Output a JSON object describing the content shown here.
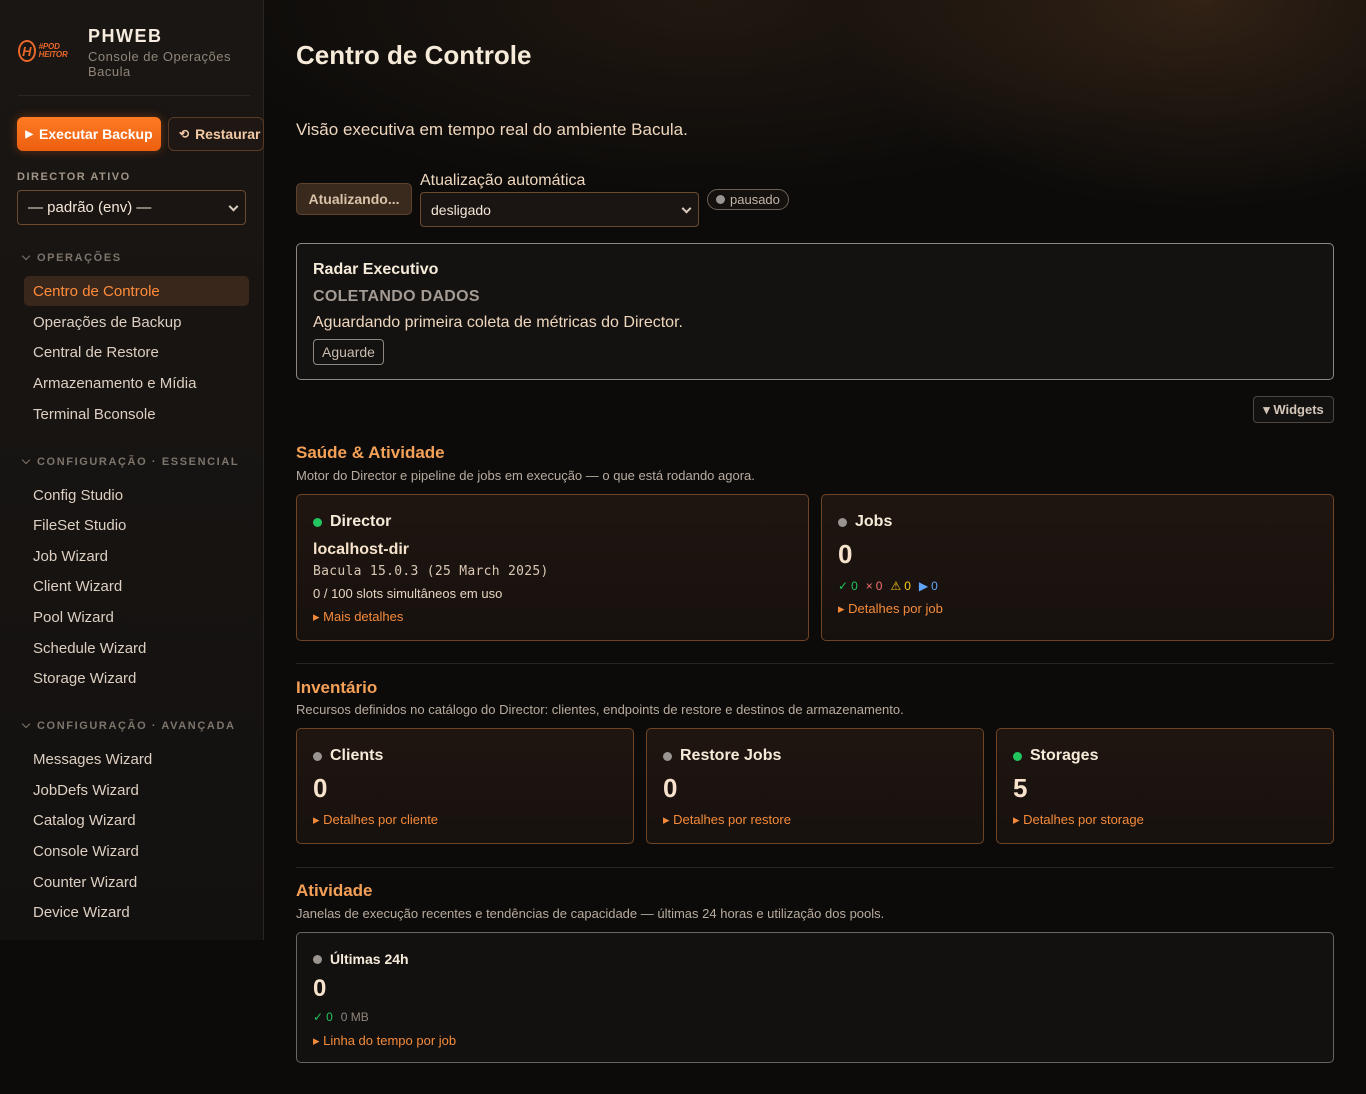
{
  "brand": {
    "logo_h": "H",
    "logo_text": "#POD HEITOR",
    "name": "PHWEB",
    "subtitle": "Console de Operações Bacula"
  },
  "sidebar": {
    "backup_label": "Executar Backup",
    "restore_label": "Restaurar",
    "director_label": "DIRECTOR ATIVO",
    "director_value": "— padrão (env) —",
    "sections": [
      {
        "title": "OPERAÇÕES",
        "items": [
          "Centro de Controle",
          "Operações de Backup",
          "Central de Restore",
          "Armazenamento e Mídia",
          "Terminal Bconsole"
        ]
      },
      {
        "title": "CONFIGURAÇÃO · ESSENCIAL",
        "items": [
          "Config Studio",
          "FileSet Studio",
          "Job Wizard",
          "Client Wizard",
          "Pool Wizard",
          "Schedule Wizard",
          "Storage Wizard"
        ]
      },
      {
        "title": "CONFIGURAÇÃO · AVANÇADA",
        "items": [
          "Messages Wizard",
          "JobDefs Wizard",
          "Catalog Wizard",
          "Console Wizard",
          "Counter Wizard",
          "Device Wizard"
        ]
      }
    ],
    "active_item": "Centro de Controle"
  },
  "header": {
    "title": "Centro de Controle",
    "subtitle": "Visão executiva em tempo real do ambiente Bacula.",
    "refresh_label": "Atualizando...",
    "auto_label": "Atualização automática",
    "auto_value": "desligado",
    "status_pill": "pausado"
  },
  "radar": {
    "title": "Radar Executivo",
    "status": "COLETANDO DADOS",
    "message": "Aguardando primeira coleta de métricas do Director.",
    "tag": "Aguarde"
  },
  "widgets_label": "▾ Widgets",
  "health": {
    "title": "Saúde & Atividade",
    "desc": "Motor do Director e pipeline de jobs em execução — o que está rodando agora.",
    "director": {
      "label": "Director",
      "host": "localhost-dir",
      "version": "Bacula 15.0.3 (25 March 2025)",
      "slots": "0 / 100 slots simultâneos em uso",
      "link": "▸ Mais detalhes"
    },
    "jobs": {
      "label": "Jobs",
      "value": "0",
      "ok": "0",
      "error": "0",
      "warn": "0",
      "running": "0",
      "link": "▸ Detalhes por job"
    }
  },
  "inventory": {
    "title": "Inventário",
    "desc": "Recursos definidos no catálogo do Director: clientes, endpoints de restore e destinos de armazenamento.",
    "cards": [
      {
        "label": "Clients",
        "value": "0",
        "link": "▸ Detalhes por cliente"
      },
      {
        "label": "Restore Jobs",
        "value": "0",
        "link": "▸ Detalhes por restore"
      },
      {
        "label": "Storages",
        "value": "5",
        "link": "▸ Detalhes por storage"
      }
    ]
  },
  "activity": {
    "title": "Atividade",
    "desc": "Janelas de execução recentes e tendências de capacidade — últimas 24 horas e utilização dos pools.",
    "card": {
      "label": "Últimas 24h",
      "value": "0",
      "ok": "0",
      "size": "0 MB",
      "link": "▸ Linha do tempo por job"
    }
  },
  "colors": {
    "accent": "#ff7a22",
    "ok": "#22c55e",
    "error": "#f87171",
    "warn": "#facc15",
    "running": "#60a5fa"
  }
}
